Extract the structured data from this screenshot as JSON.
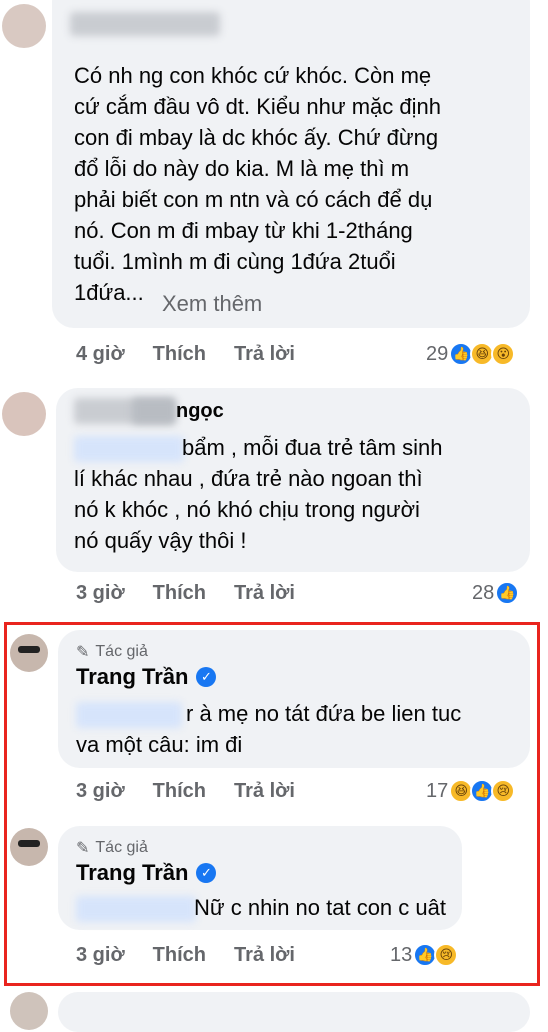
{
  "comments": [
    {
      "text": "Có nh ng con khóc cứ khóc. Còn mẹ\ncứ cắm đầu vô dt. Kiểu như mặc định\ncon đi mbay là dc khóc ấy. Chứ đừng\nđổ lỗi do này do kia. M là mẹ thì m\nphải biết con m ntn và có cách để dụ\nnó. Con m đi mbay từ khi 1-2tháng\ntuổi. 1mình m đi cùng 1đứa 2tuổi\n1đứa...",
      "see_more": "Xem thêm",
      "time": "4 giờ",
      "like_label": "Thích",
      "reply_label": "Trả lời",
      "reactions_count": "29"
    },
    {
      "name_partial": "ngọc",
      "text": "bẩm , mỗi đua trẻ tâm sinh\nlí khác nhau , đứa trẻ nào ngoan thì\nnó k khóc , nó khó chịu trong người\nnó quấy vậy thôi !",
      "time": "3 giờ",
      "like_label": "Thích",
      "reply_label": "Trả lời",
      "reactions_count": "28"
    }
  ],
  "replies": [
    {
      "author_tag": "Tác giả",
      "name": "Trang Trần",
      "text": "r à mẹ no tát đứa be lien tuc\nva một câu: im đi",
      "time": "3 giờ",
      "like_label": "Thích",
      "reply_label": "Trả lời",
      "reactions_count": "17"
    },
    {
      "author_tag": "Tác giả",
      "name": "Trang Trần",
      "text": "Nữ c nhin no tat con c uât",
      "time": "3 giờ",
      "like_label": "Thích",
      "reply_label": "Trả lời",
      "reactions_count": "13"
    }
  ],
  "colors": {
    "bubble": "#f0f2f5",
    "highlight_border": "#e9241e",
    "like_blue": "#1877f2",
    "meta_gray": "#65676b"
  }
}
